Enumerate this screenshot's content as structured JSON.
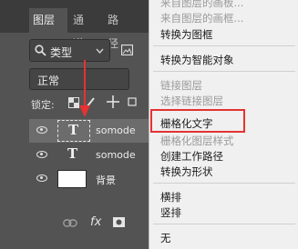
{
  "layers_panel": {
    "tabs": [
      "图层",
      "通道",
      "路径"
    ],
    "filter": {
      "icon": "search-icon",
      "label": "类型"
    },
    "blend_mode": "正常",
    "lock_label": "锁定:",
    "layers": [
      {
        "name": "somode",
        "type": "text",
        "visible": true,
        "selected": true
      },
      {
        "name": "somode",
        "type": "text",
        "visible": true,
        "selected": false
      },
      {
        "name": "背景",
        "type": "fill",
        "visible": true,
        "selected": false
      }
    ],
    "bottom_icons": [
      "link-icon",
      "fx-icon",
      "mask-icon"
    ],
    "fx_label": "fx"
  },
  "context_menu": {
    "items": [
      {
        "label": "来自图层的画板...",
        "enabled": false
      },
      {
        "label": "来自图层的画框...",
        "enabled": false
      },
      {
        "label": "转换为图框",
        "enabled": true
      },
      {
        "label": "转换为智能对象",
        "enabled": true
      },
      {
        "label": "链接图层",
        "enabled": false
      },
      {
        "label": "选择链接图层",
        "enabled": false
      },
      {
        "label": "栅格化文字",
        "enabled": true,
        "highlighted": true
      },
      {
        "label": "栅格化图层样式",
        "enabled": false
      },
      {
        "label": "创建工作路径",
        "enabled": true
      },
      {
        "label": "转换为形状",
        "enabled": true
      },
      {
        "label": "横排",
        "enabled": true
      },
      {
        "label": "竖排",
        "enabled": true
      },
      {
        "label": "无",
        "enabled": true
      }
    ]
  },
  "colors": {
    "panel_bg": "#535353",
    "menu_bg": "#f0f0f0",
    "highlight_box": "#e53232",
    "arrow": "#e53232"
  }
}
